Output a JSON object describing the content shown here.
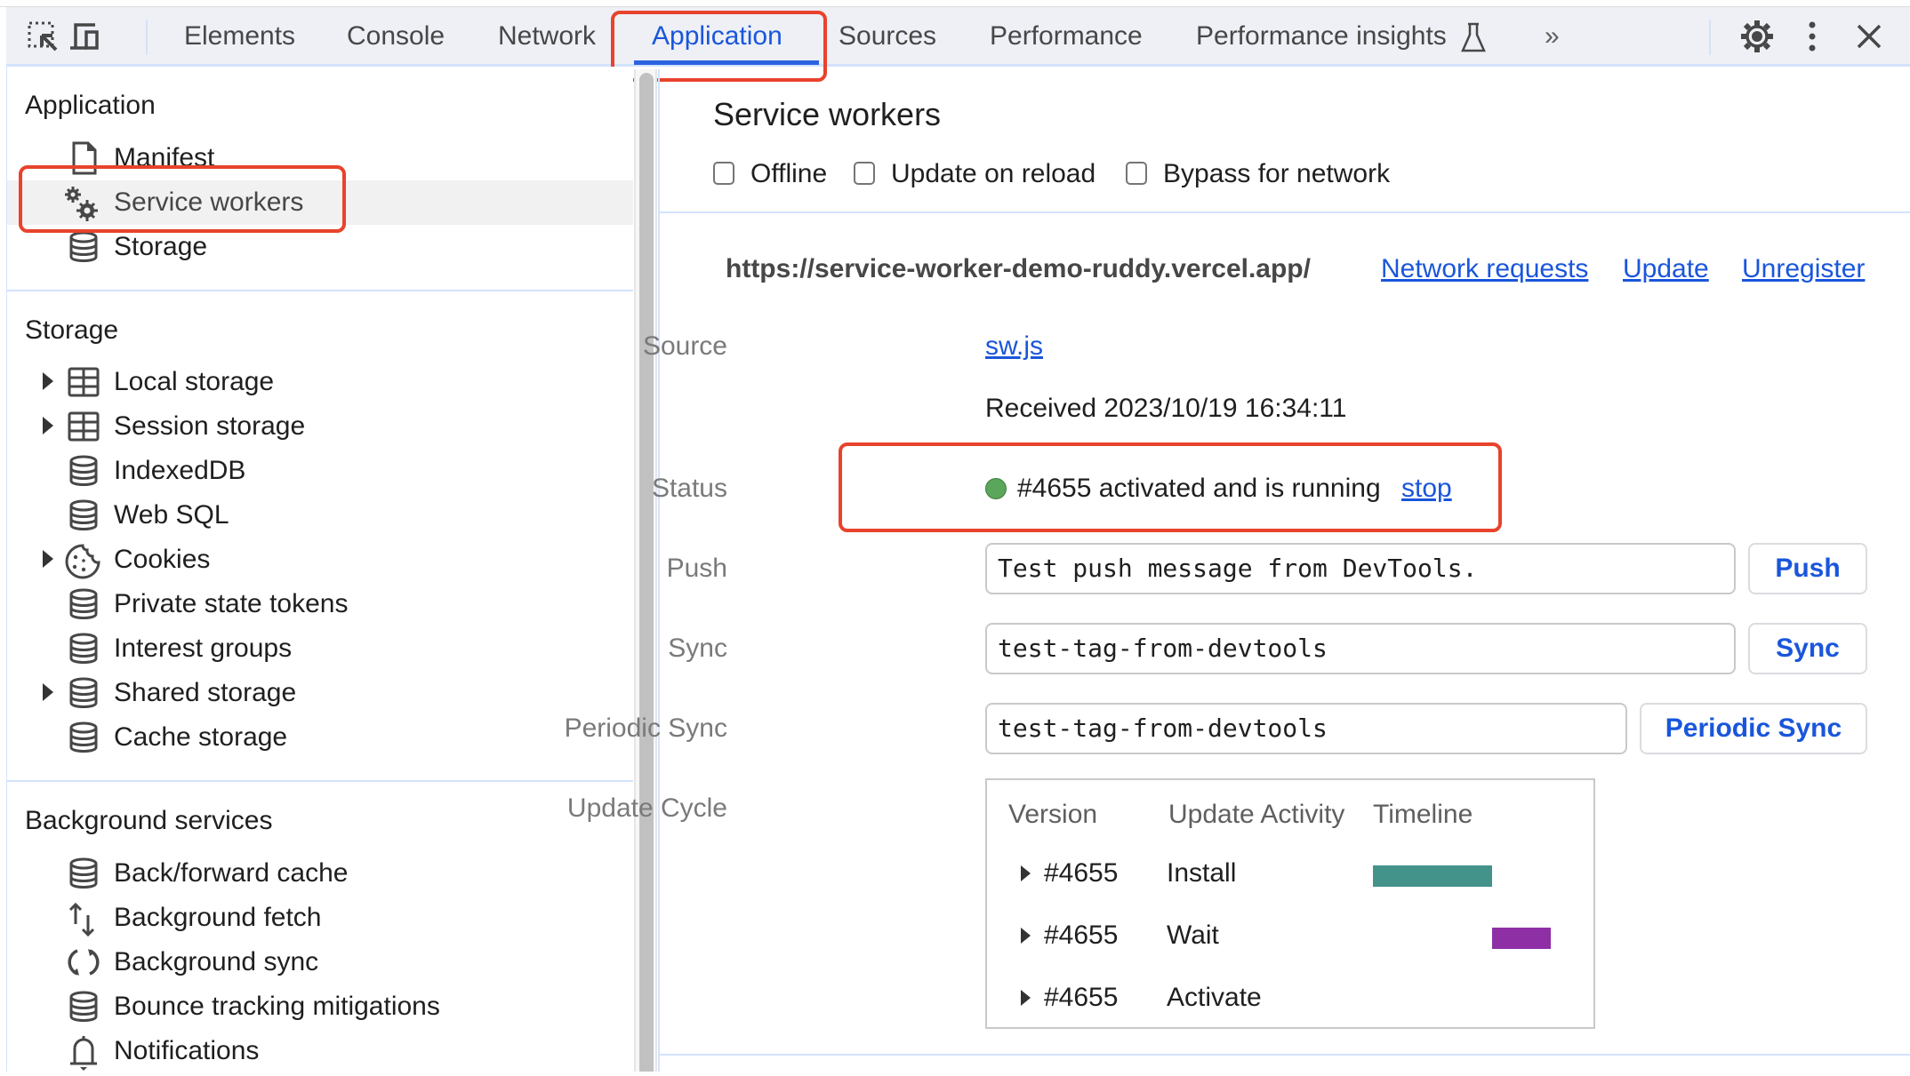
{
  "toolbar": {
    "left_icons": [
      "inspect-element-icon",
      "device-toolbar-icon"
    ],
    "tabs": [
      {
        "label": "Elements",
        "active": false
      },
      {
        "label": "Console",
        "active": false
      },
      {
        "label": "Network",
        "active": false
      },
      {
        "label": "Application",
        "active": true
      },
      {
        "label": "Sources",
        "active": false
      },
      {
        "label": "Performance",
        "active": false
      },
      {
        "label": "Performance insights",
        "active": false,
        "icon": "flask-icon"
      }
    ],
    "more_tabs_label": "»",
    "right_icons": [
      "settings-gear-icon",
      "more-vertical-icon",
      "close-icon"
    ]
  },
  "sidebar": {
    "sections": [
      {
        "title": "Application",
        "items": [
          {
            "label": "Manifest",
            "icon": "document-icon",
            "expandable": false,
            "selected": false
          },
          {
            "label": "Service workers",
            "icon": "gears-icon",
            "expandable": false,
            "selected": true
          },
          {
            "label": "Storage",
            "icon": "database-icon",
            "expandable": false,
            "selected": false
          }
        ]
      },
      {
        "title": "Storage",
        "items": [
          {
            "label": "Local storage",
            "icon": "table-icon",
            "expandable": true
          },
          {
            "label": "Session storage",
            "icon": "table-icon",
            "expandable": true
          },
          {
            "label": "IndexedDB",
            "icon": "database-icon",
            "expandable": false
          },
          {
            "label": "Web SQL",
            "icon": "database-icon",
            "expandable": false
          },
          {
            "label": "Cookies",
            "icon": "cookie-icon",
            "expandable": true
          },
          {
            "label": "Private state tokens",
            "icon": "database-icon",
            "expandable": false
          },
          {
            "label": "Interest groups",
            "icon": "database-icon",
            "expandable": false
          },
          {
            "label": "Shared storage",
            "icon": "database-icon",
            "expandable": true
          },
          {
            "label": "Cache storage",
            "icon": "database-icon",
            "expandable": false
          }
        ]
      },
      {
        "title": "Background services",
        "items": [
          {
            "label": "Back/forward cache",
            "icon": "database-icon"
          },
          {
            "label": "Background fetch",
            "icon": "up-down-arrows-icon"
          },
          {
            "label": "Background sync",
            "icon": "sync-icon"
          },
          {
            "label": "Bounce tracking mitigations",
            "icon": "database-icon"
          },
          {
            "label": "Notifications",
            "icon": "bell-icon"
          }
        ]
      }
    ]
  },
  "main": {
    "title": "Service workers",
    "checkboxes": [
      {
        "label": "Offline",
        "checked": false
      },
      {
        "label": "Update on reload",
        "checked": false
      },
      {
        "label": "Bypass for network",
        "checked": false
      }
    ],
    "origin": "https://service-worker-demo-ruddy.vercel.app/",
    "origin_links": [
      "Network requests",
      "Update",
      "Unregister"
    ],
    "source_label": "Source",
    "source_link": "sw.js",
    "received": "Received 2023/10/19 16:34:11",
    "status_label": "Status",
    "status_color": "#5aa65a",
    "status_text": "#4655 activated and is running",
    "status_action": "stop",
    "push_label": "Push",
    "push_value": "Test push message from DevTools.",
    "push_button": "Push",
    "sync_label": "Sync",
    "sync_value": "test-tag-from-devtools",
    "sync_button": "Sync",
    "periodic_label": "Periodic Sync",
    "periodic_value": "test-tag-from-devtools",
    "periodic_button": "Periodic Sync",
    "update_cycle_label": "Update Cycle",
    "update_cycle": {
      "headers": [
        "Version",
        "Update Activity",
        "Timeline"
      ],
      "rows": [
        {
          "version": "#4655",
          "activity": "Install",
          "bar_color": "#43938a",
          "timeline_start": 0.0,
          "timeline_end": 0.67
        },
        {
          "version": "#4655",
          "activity": "Wait",
          "bar_color": "#8e2fa6",
          "timeline_start": 0.67,
          "timeline_end": 1.0
        },
        {
          "version": "#4655",
          "activity": "Activate",
          "bar_color": null,
          "timeline_start": null,
          "timeline_end": null
        }
      ]
    }
  },
  "highlight_color": "#e8432c",
  "accent_color": "#1a56db"
}
